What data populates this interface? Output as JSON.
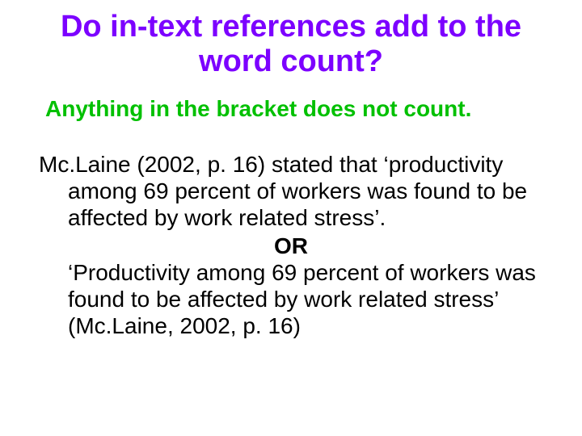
{
  "title": "Do in-text references add to the word count?",
  "subtitle": "Anything in the bracket does not count.",
  "body": {
    "para1": "Mc.Laine (2002, p. 16) stated that ‘productivity among 69 percent of workers was found to be affected by work related stress’.",
    "or": "OR",
    "para2": "‘Productivity among 69 percent of workers was found to be affected by work related stress’ (Mc.Laine, 2002, p. 16)"
  }
}
